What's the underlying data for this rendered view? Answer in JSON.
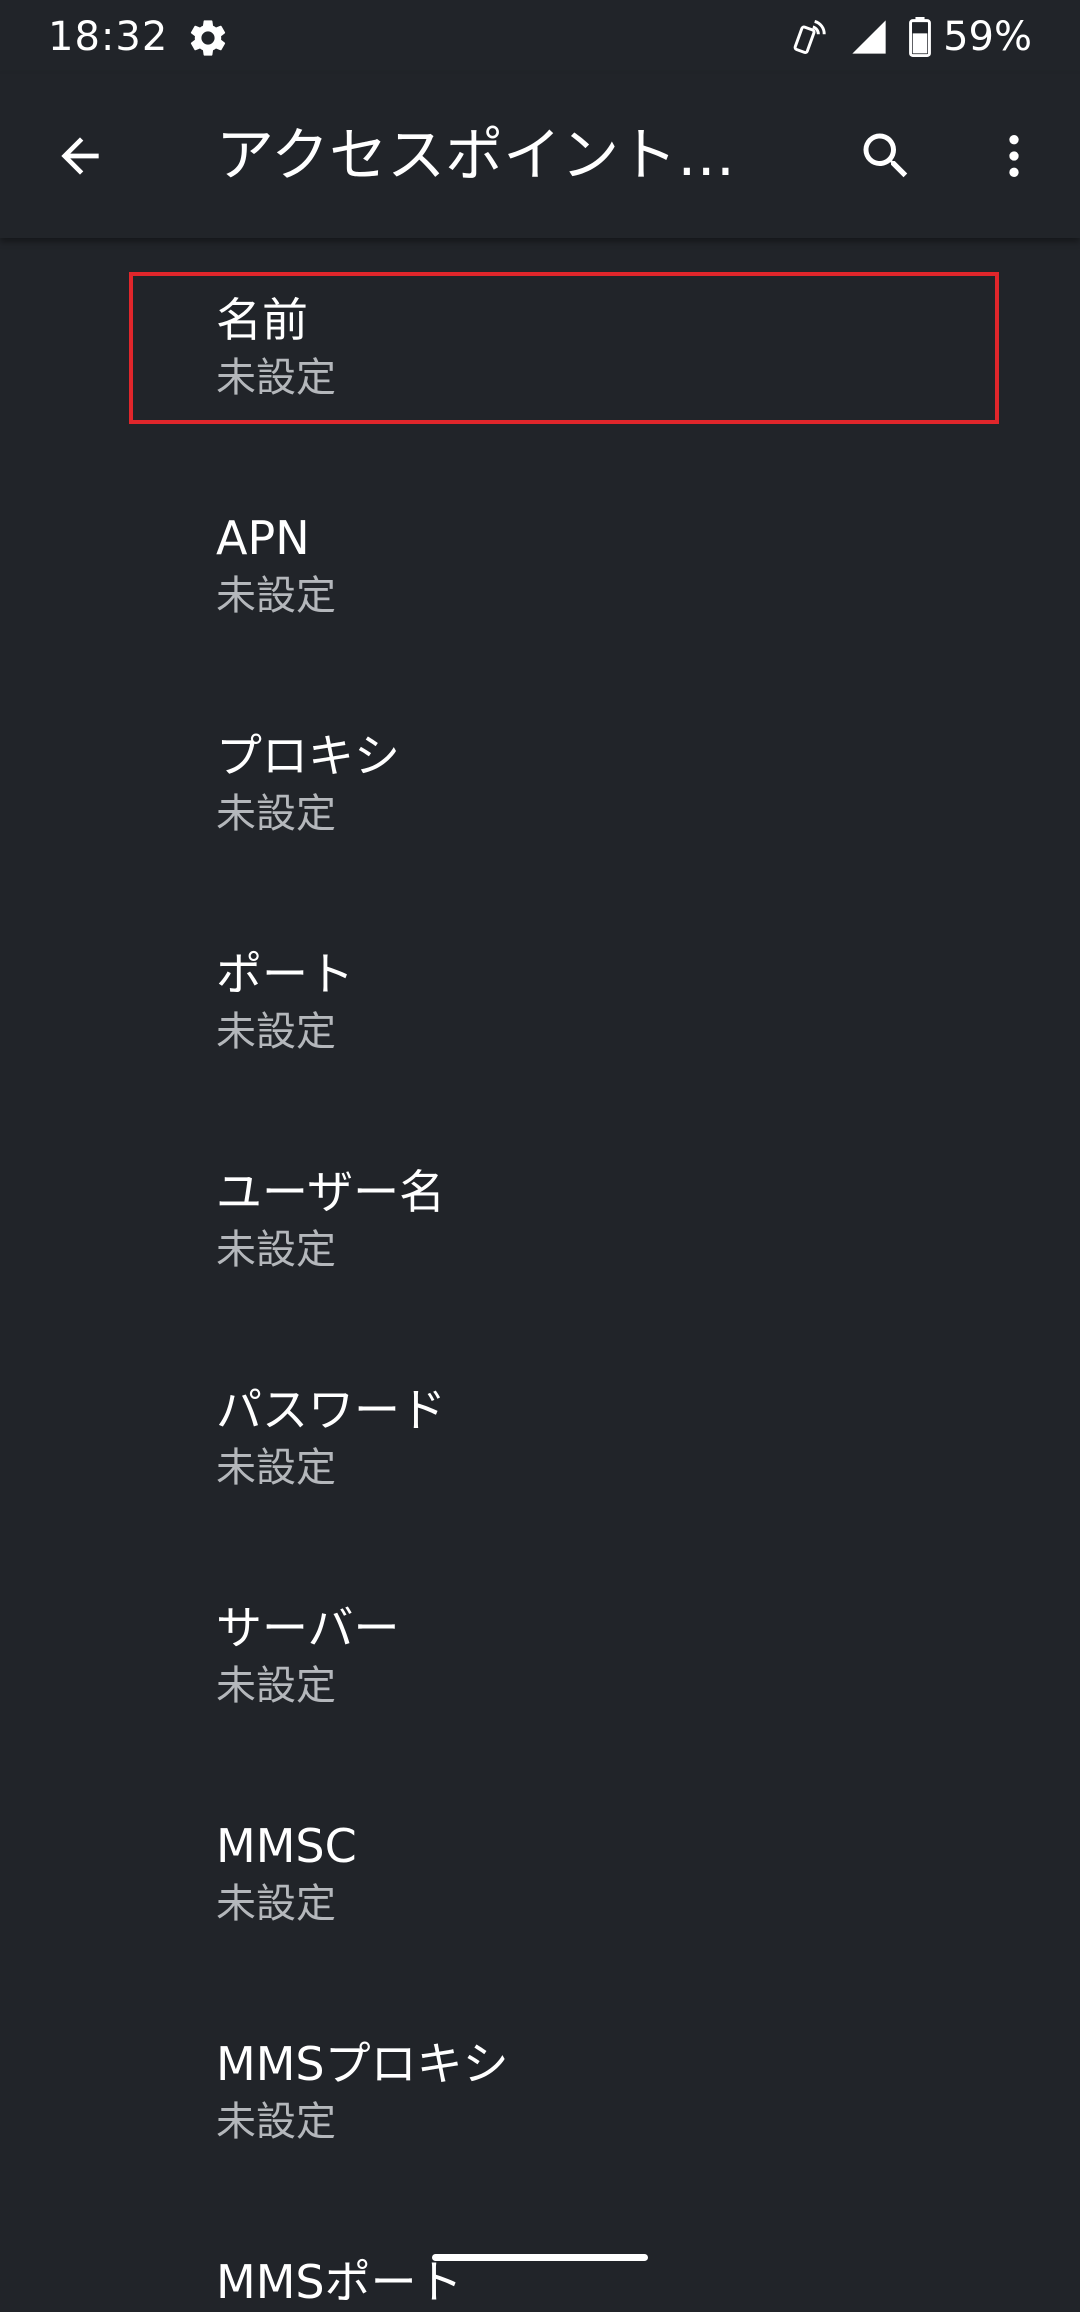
{
  "status_bar": {
    "time": "18:32",
    "battery": "59%",
    "icons": [
      "gear-icon",
      "nfc-icon",
      "signal-icon",
      "battery-icon"
    ]
  },
  "app_bar": {
    "title": "アクセスポイント…",
    "back_icon": "arrow-back-icon",
    "search_icon": "search-icon",
    "more_icon": "more-vert-icon"
  },
  "list": {
    "items": [
      {
        "title": "名前",
        "summary": "未設定"
      },
      {
        "title": "APN",
        "summary": "未設定"
      },
      {
        "title": "プロキシ",
        "summary": "未設定"
      },
      {
        "title": "ポート",
        "summary": "未設定"
      },
      {
        "title": "ユーザー名",
        "summary": "未設定"
      },
      {
        "title": "パスワード",
        "summary": "未設定"
      },
      {
        "title": "サーバー",
        "summary": "未設定"
      },
      {
        "title": "MMSC",
        "summary": "未設定"
      },
      {
        "title": "MMSプロキシ",
        "summary": "未設定"
      },
      {
        "title": "MMSポート",
        "summary": ""
      }
    ]
  },
  "colors": {
    "background": "#212429",
    "text_primary": "#ffffff",
    "text_secondary": "#b4b7bb",
    "highlight": "#e0262b"
  }
}
